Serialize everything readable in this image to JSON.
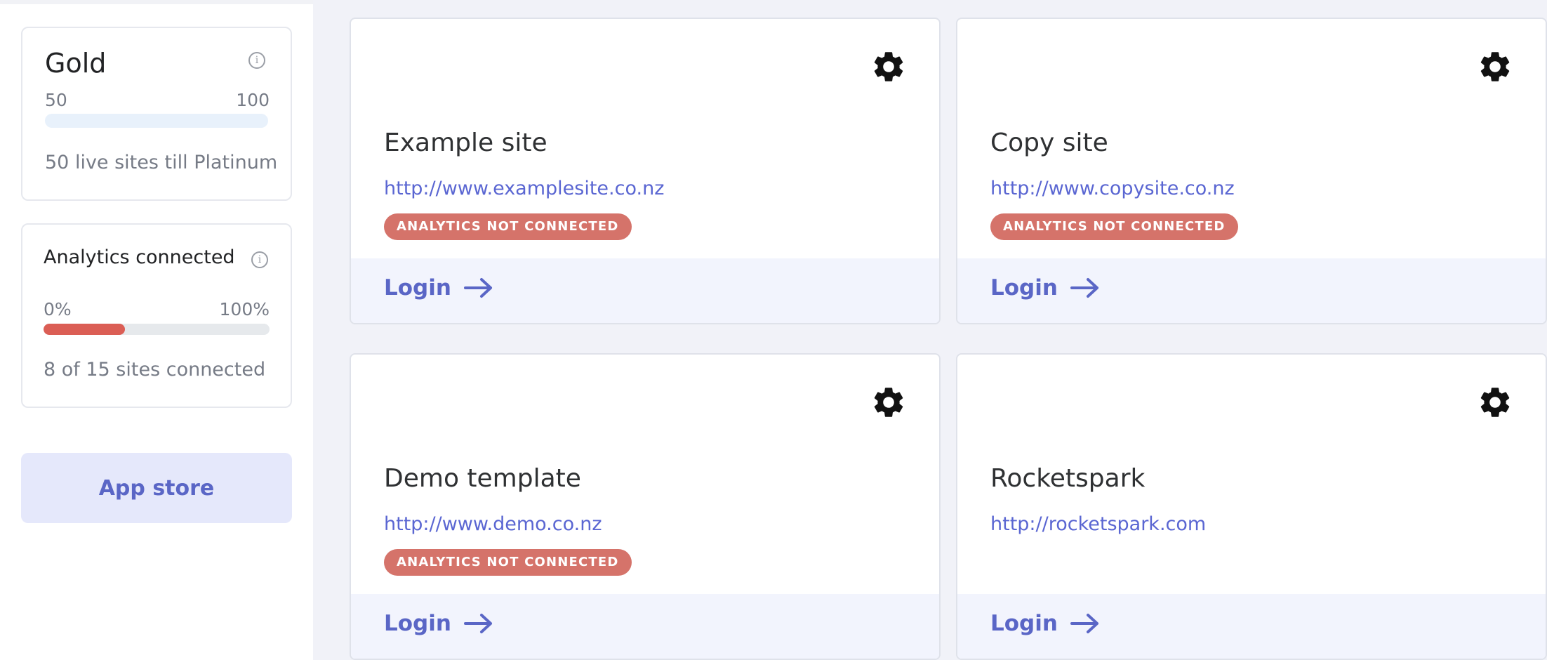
{
  "sidebar": {
    "tier": {
      "title": "Gold",
      "range_min": "50",
      "range_max": "100",
      "progress_fraction": 0.0,
      "note": "50 live sites till Platinum"
    },
    "analytics": {
      "title": "Analytics connected",
      "range_min": "0%",
      "range_max": "100%",
      "progress_fraction": 0.36,
      "note": "8 of 15 sites connected"
    },
    "app_store_label": "App store"
  },
  "sites": [
    {
      "name": "Example site",
      "url": "http://www.examplesite.co.nz",
      "badge": "ANALYTICS NOT CONNECTED",
      "login_label": "Login"
    },
    {
      "name": "Copy site",
      "url": "http://www.copysite.co.nz",
      "badge": "ANALYTICS NOT CONNECTED",
      "login_label": "Login"
    },
    {
      "name": "Demo template",
      "url": "http://www.demo.co.nz",
      "badge": "ANALYTICS NOT CONNECTED",
      "login_label": "Login"
    },
    {
      "name": "Rocketspark",
      "url": "http://rocketspark.com",
      "badge": "",
      "login_label": "Login"
    }
  ],
  "icons": {
    "info": "info-icon",
    "settings": "gear-icon",
    "login_arrow": "arrow-right-icon"
  },
  "colors": {
    "accent": "#5a66c6",
    "badge_bg": "#d5736a",
    "analytics_fill": "#db5e55",
    "main_bg": "#f1f2f8"
  }
}
